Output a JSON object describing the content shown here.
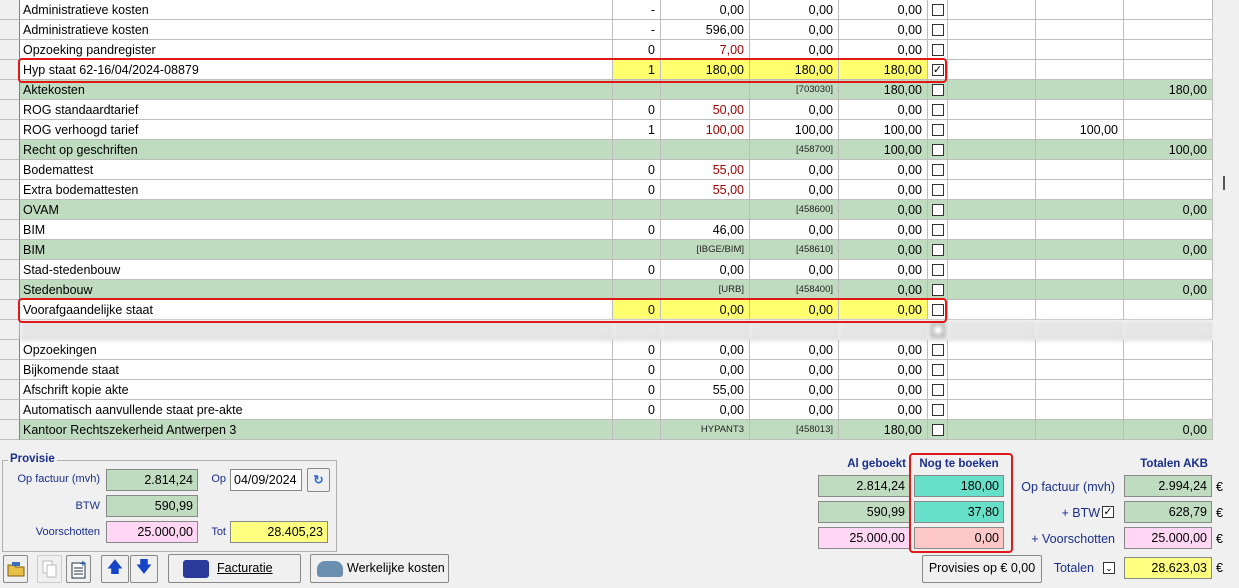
{
  "rows": [
    {
      "name": "Administratieve kosten",
      "qty": "-",
      "price": "0,00",
      "amt1": "0,00",
      "amt2": "0,00",
      "checked": false
    },
    {
      "name": "Administratieve kosten",
      "qty": "-",
      "price": "596,00",
      "amt1": "0,00",
      "amt2": "0,00",
      "checked": false
    },
    {
      "name": "Opzoeking pandregister",
      "qty": "0",
      "price": "7,00",
      "amt1": "0,00",
      "amt2": "0,00",
      "checked": false
    },
    {
      "name": "Hyp staat 62-16/04/2024-08879",
      "qty": "1",
      "price": "180,00",
      "amt1": "180,00",
      "amt2": "180,00",
      "checked": true
    },
    {
      "name": "Aktekosten",
      "qty": "",
      "price": "",
      "amt1": "[703030]",
      "amt2": "180,00",
      "checked": false,
      "e3": "180,00"
    },
    {
      "name": "ROG standaardtarief",
      "qty": "0",
      "price": "50,00",
      "amt1": "0,00",
      "amt2": "0,00",
      "checked": false
    },
    {
      "name": "ROG verhoogd tarief",
      "qty": "1",
      "price": "100,00",
      "amt1": "100,00",
      "amt2": "100,00",
      "checked": false,
      "e2": "100,00"
    },
    {
      "name": "Recht op geschriften",
      "qty": "",
      "price": "",
      "amt1": "[458700]",
      "amt2": "100,00",
      "checked": false,
      "e3": "100,00"
    },
    {
      "name": "Bodemattest",
      "qty": "0",
      "price": "55,00",
      "amt1": "0,00",
      "amt2": "0,00",
      "checked": false
    },
    {
      "name": "Extra bodemattesten",
      "qty": "0",
      "price": "55,00",
      "amt1": "0,00",
      "amt2": "0,00",
      "checked": false
    },
    {
      "name": "OVAM",
      "qty": "",
      "price": "",
      "amt1": "[458600]",
      "amt2": "0,00",
      "checked": false,
      "e3": "0,00"
    },
    {
      "name": "BIM",
      "qty": "0",
      "price": "46,00",
      "amt1": "0,00",
      "amt2": "0,00",
      "checked": false
    },
    {
      "name": "BIM",
      "qty": "",
      "price": "[IBGE/BIM]",
      "amt1": "[458610]",
      "amt2": "0,00",
      "checked": false,
      "e3": "0,00"
    },
    {
      "name": "Stad-stedenbouw",
      "qty": "0",
      "price": "0,00",
      "amt1": "0,00",
      "amt2": "0,00",
      "checked": false
    },
    {
      "name": "Stedenbouw",
      "qty": "",
      "price": "[URB]",
      "amt1": "[458400]",
      "amt2": "0,00",
      "checked": false,
      "e3": "0,00"
    },
    {
      "name": "Voorafgaandelijke staat",
      "qty": "0",
      "price": "0,00",
      "amt1": "0,00",
      "amt2": "0,00",
      "checked": false
    },
    {
      "name": "",
      "qty": "",
      "price": "",
      "amt1": "",
      "amt2": "",
      "checked": false
    },
    {
      "name": "Opzoekingen",
      "qty": "0",
      "price": "0,00",
      "amt1": "0,00",
      "amt2": "0,00",
      "checked": false
    },
    {
      "name": "Bijkomende staat",
      "qty": "0",
      "price": "0,00",
      "amt1": "0,00",
      "amt2": "0,00",
      "checked": false
    },
    {
      "name": "Afschrift kopie akte",
      "qty": "0",
      "price": "55,00",
      "amt1": "0,00",
      "amt2": "0,00",
      "checked": false
    },
    {
      "name": "Automatisch aanvullende staat pre-akte",
      "qty": "0",
      "price": "0,00",
      "amt1": "0,00",
      "amt2": "0,00",
      "checked": false
    },
    {
      "name": "Kantoor Rechtszekerheid Antwerpen 3",
      "qty": "",
      "price": "HYPANT3",
      "amt1": "[458013]",
      "amt2": "180,00",
      "checked": false,
      "e3": "0,00"
    }
  ],
  "provisie": {
    "title": "Provisie",
    "op_factuur_label": "Op factuur (mvh)",
    "op_factuur": "2.814,24",
    "op_label": "Op",
    "op_date": "04/09/2024",
    "btw_label": "BTW",
    "btw": "590,99",
    "voorschotten_label": "Voorschotten",
    "voorschotten": "25.000,00",
    "tot_label": "Tot",
    "tot": "28.405,23"
  },
  "summary": {
    "al_geboekt_title": "Al geboekt",
    "nog_title": "Nog te boeken",
    "totalen_title": "Totalen AKB",
    "al_geboekt": [
      "2.814,24",
      "590,99",
      "25.000,00"
    ],
    "nog": [
      "180,00",
      "37,80",
      "0,00"
    ],
    "labels": [
      "Op factuur (mvh)",
      "+ BTW",
      "+ Voorschotten"
    ],
    "totalen": [
      "2.994,24",
      "628,79",
      "25.000,00"
    ],
    "euro": "€",
    "totalen_label": "Totalen",
    "totalen_sum": "28.623,03"
  },
  "toolbar": {
    "facturatie": "Facturatie",
    "werkelijke": "Werkelijke kosten",
    "provisies": "Provisies op € 0,00"
  }
}
